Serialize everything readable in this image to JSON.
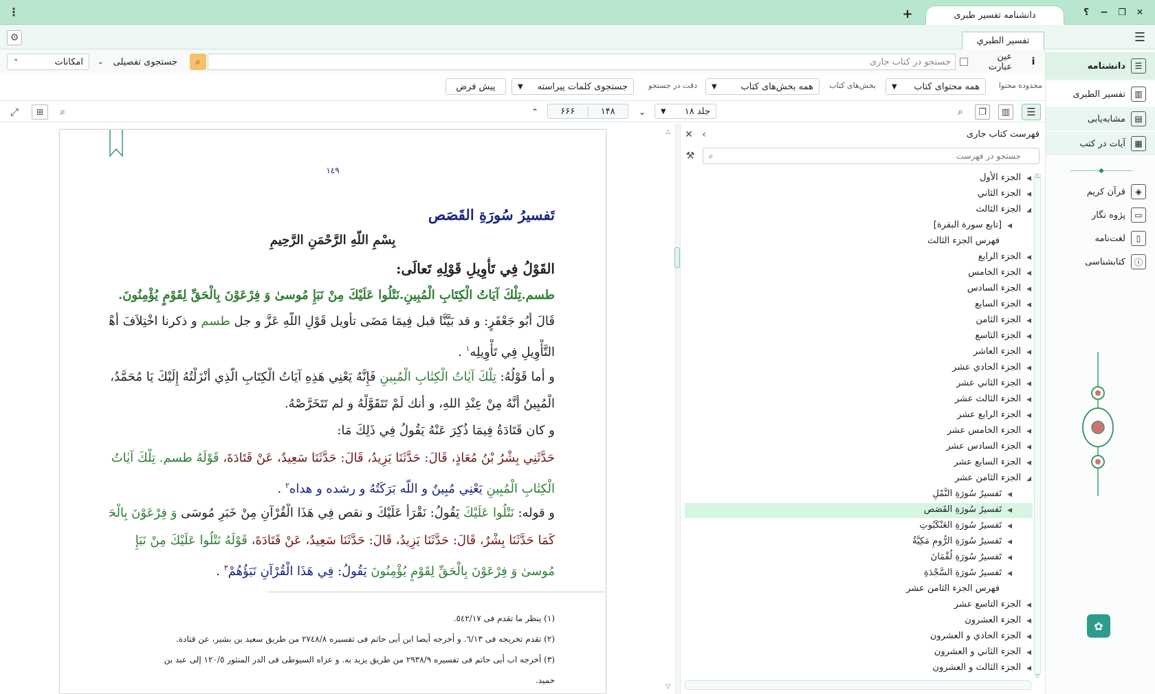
{
  "window": {
    "tab_title": "دانشنامه تفسیر طبری",
    "new_tab": "+",
    "help": "؟",
    "minimize": "−",
    "restore": "❐",
    "close": "✕",
    "menu": "⋮"
  },
  "book_tab": "تفسير الطبري",
  "search": {
    "placeholder": "جستجو در کتاب جاری",
    "exact_phrase": "عین عبارت",
    "info": "i",
    "advanced": "جستجوی تفصیلی",
    "options": "امکانات"
  },
  "scope": {
    "content_scope_label": "محدوده محتوا",
    "content_scope_value": "همه محتوای کتاب",
    "sections_label": "بخش‌های کتاب",
    "sections_value": "همه بخش‌های کتاب",
    "precision_label": "دقت در جستجو",
    "precision_value": "جستجوی کلمات پیراسته",
    "default_button": "پیش فرض"
  },
  "nav": {
    "volume": "جلد ۱۸",
    "page": "۱۴۸",
    "total_pages": "۶۶۶"
  },
  "sidebar": {
    "header": "دانشنامه",
    "items": [
      {
        "label": "تفسیر الطبری",
        "icon": "books-icon"
      },
      {
        "label": "مشابه‌یابی",
        "icon": "similar-icon"
      },
      {
        "label": "آیات در کتب",
        "icon": "verses-icon"
      }
    ],
    "tools": [
      {
        "label": "قرآن کریم",
        "icon": "quran-icon"
      },
      {
        "label": "پژوه نگار",
        "icon": "notebook-icon"
      },
      {
        "label": "لغت‌نامه",
        "icon": "dictionary-icon"
      },
      {
        "label": "کتابشناسی",
        "icon": "info-book-icon"
      }
    ]
  },
  "document": {
    "page_number": "١٤٩",
    "surah_title": "تَفسيرُ سُورَةِ القَصَص",
    "basmala": "بِسْمِ اللّهِ الرَّحْمَنِ الرَّحِيمِ",
    "heading": "القَوْلُ فِي تَأْوِيلِ قَوْلِهِ تَعالَى:",
    "verse": "طسم.تِلْكَ آيَاتُ الْكِتَابِ الْمُبِينِ.نَتْلُوا عَلَيْكَ مِنْ نَبَإِ مُوسىٰ وَ فِرْعَوْنَ بِالْحَقِّ لِقَوْمٍ يُؤْمِنُونَ.",
    "p1a": "قَالَ أَبُو جَعْفَرٍ: و قد بَيَّنَّا قبل فِيمَا مَضَى تأويل قَوْلِ اللّهِ عَزَّ و جل",
    "p1b": "طسم",
    "p1c": "و ذكرنا اخْتِلاَفَ أَهْلِ",
    "p1d": "التَّأْوِيلِ فِي تَأْوِيلِه",
    "fn1": "١",
    "p2a": "و أما قَوْلُهُ:",
    "p2b": "تِلْكَ آيٰاتُ الْكِتٰابِ الْمُبِينِ",
    "p2c": "فَإِنَّهُ يَعْنِي هَذِهِ آيَاتُ الْكِتَابِ الَّذِي أَنْزَلْتُهُ إِلَيْكَ يَا مُحَمَّدُ،",
    "p2d": "الْمُبِينُ أَنَّهُ مِنْ عِنْدِ اللهِ، و أنك لَمْ تَتَقَوَّلْهُ و لم تَتَخَرَّصْهُ.",
    "p3": "و كان قَتَادَةُ فِيمَا ذُكِرَ عَنْهُ يَقُولُ فِي ذَلِكَ مَا:",
    "p4a": "حَدَّثَنِي بِشْرُ بْنُ مُعَاذٍ، قَالَ: حَدَّثَنَا يَزِيدُ، قَالَ: حَدَّثَنَا سَعِيدٌ، عَنْ قَتَادَةَ،",
    "p4b": "قَوْلَهُ طسم. تِلْكَ آيٰاتُ",
    "p4c": "الْكِتٰابِ الْمُبِينِ",
    "p4d": "يَعْنِي مُبِينٌ و اللّه بَرَكَتُهُ و رشده و هداه",
    "fn2": "٢",
    "p5a": "و قوله:",
    "p5b": "نَتْلُوا عَلَيْكَ",
    "p5c": "يَقُولُ: نَقْرَأُ عَلَيْكَ و نقص فِي هَذَا الْقُرْآنِ مِنْ خَبَرِ مُوسَى",
    "p5d": "وَ فِرْعَوْنَ بِالْحَقِّ.",
    "p6a": "كَمَا حَدَّثَنَا بِشْرٌ، قَالَ: حَدَّثَنَا يَزِيدُ، قَالَ: حَدَّثَنَا سَعِيدٌ، عَنْ قَتَادَةَ،",
    "p6b": "قَوْلَهُ نَتْلُوا عَلَيْكَ مِنْ نَبَإِ",
    "p6c": "مُوسىٰ وَ فِرْعَوْنَ بِالْحَقِّ لِقَوْمٍ يُؤْمِنُونَ",
    "p6d": "يَقُولُ: فِي هَذَا الْقُرْآنِ نَبَؤُهُمْ",
    "fn3": "٣",
    "footnotes": [
      "(١) ينظر ما تقدم فى ٥٤٢/١٧.",
      "(٢) تقدم تخريجه فى ٦/١٣. و أخرجه أيضا ابن أبى حاتم فى تفسيره ٢٧٤٨/٨ من طريق سعيد بن بشير، عن قتادة.",
      "(٣) أخرجه اب أبى حاتم فى تفسيره ٢٩٣٨/٩ من طريق يزيد به. و عزاه السيوطى فى الدر المنثور ١٢٠/٥ إلى عبد بن",
      "حميد."
    ]
  },
  "toc": {
    "title": "فهرست کتاب جاری",
    "search_placeholder": "جستجو در فهرست",
    "items": [
      {
        "label": "الجزء الأول",
        "level": 0,
        "open": false
      },
      {
        "label": "الجزء الثاني",
        "level": 0,
        "open": false
      },
      {
        "label": "الجزء الثالث",
        "level": 0,
        "open": true
      },
      {
        "label": "[تابع سورة البقرة]",
        "level": 1,
        "open": false
      },
      {
        "label": "فهرس الجزء الثالث",
        "level": 1,
        "open": null
      },
      {
        "label": "الجزء الرابع",
        "level": 0,
        "open": false
      },
      {
        "label": "الجزء الخامس",
        "level": 0,
        "open": false
      },
      {
        "label": "الجزء السادس",
        "level": 0,
        "open": false
      },
      {
        "label": "الجزء السابع",
        "level": 0,
        "open": false
      },
      {
        "label": "الجزء الثامن",
        "level": 0,
        "open": false
      },
      {
        "label": "الجزء التاسع",
        "level": 0,
        "open": false
      },
      {
        "label": "الجزء العاشر",
        "level": 0,
        "open": false
      },
      {
        "label": "الجزء الحادي عشر",
        "level": 0,
        "open": false
      },
      {
        "label": "الجزء الثاني عشر",
        "level": 0,
        "open": false
      },
      {
        "label": "الجزء الثالث عشر",
        "level": 0,
        "open": false
      },
      {
        "label": "الجزء الرابع عشر",
        "level": 0,
        "open": false
      },
      {
        "label": "الجزء الخامس عشر",
        "level": 0,
        "open": false
      },
      {
        "label": "الجزء السادس عشر",
        "level": 0,
        "open": false
      },
      {
        "label": "الجزء السابع عشر",
        "level": 0,
        "open": false
      },
      {
        "label": "الجزء الثامن عشر",
        "level": 0,
        "open": true
      },
      {
        "label": "تَفسيرُ سُورَةِ النَّمْلِ",
        "level": 1,
        "open": false
      },
      {
        "label": "تَفسيرُ سُورَةِ القَصَص",
        "level": 1,
        "open": false,
        "selected": true
      },
      {
        "label": "تَفسيرُ سُورَةِ العَنْكَبُوتِ",
        "level": 1,
        "open": false
      },
      {
        "label": "تَفسيرُ سُورَةِ الرُّومِ مَكِيَّةٌ",
        "level": 1,
        "open": false
      },
      {
        "label": "تَفسيرُ سُورَةِ لُقْمَانَ",
        "level": 1,
        "open": false
      },
      {
        "label": "تَفسيرُ سُورَةِ السَّجْدَةِ",
        "level": 1,
        "open": false
      },
      {
        "label": "فهرس الجزء الثامن عشر",
        "level": 1,
        "open": null
      },
      {
        "label": "الجزء التاسع عشر",
        "level": 0,
        "open": false
      },
      {
        "label": "الجزء العشرون",
        "level": 0,
        "open": false
      },
      {
        "label": "الجزء الحادي و العشرون",
        "level": 0,
        "open": false
      },
      {
        "label": "الجزء الثاني و العشرون",
        "level": 0,
        "open": false
      },
      {
        "label": "الجزء الثالث و العشرون",
        "level": 0,
        "open": false
      }
    ]
  },
  "colors": {
    "accent_green": "#2e7d32",
    "hadith_maroon": "#6d1b1b",
    "title_navy": "#1a237e",
    "chrome_mint": "#b9e6cf",
    "selection": "#d7f5e5",
    "search_button": "#f5c26b"
  }
}
